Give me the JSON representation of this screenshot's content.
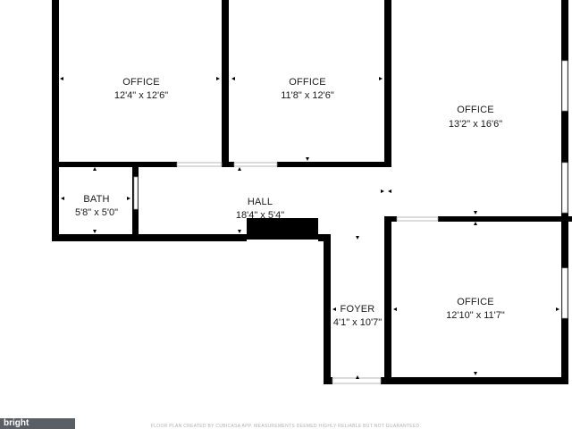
{
  "rooms": {
    "office_top_left": {
      "name": "OFFICE",
      "dim": "12'4\" x 12'6\""
    },
    "office_top_middle": {
      "name": "OFFICE",
      "dim": "11'8\" x 12'6\""
    },
    "office_right_large": {
      "name": "OFFICE",
      "dim": "13'2\" x 16'6\""
    },
    "bath": {
      "name": "BATH",
      "dim": "5'8\" x 5'0\""
    },
    "hall": {
      "name": "HALL",
      "dim": "18'4\" x 5'4\""
    },
    "foyer": {
      "name": "FOYER",
      "dim": "4'1\" x 10'7\""
    },
    "office_bottom_right": {
      "name": "OFFICE",
      "dim": "12'10\" x 11'7\""
    }
  },
  "footer": {
    "note": "FLOOR PLAN CREATED BY CUBICASA APP. MEASUREMENTS DEEMED HIGHLY RELIABLE BUT NOT GUARANTEED.",
    "brand": "bright"
  },
  "colors": {
    "wall": "#000000",
    "background": "#ffffff",
    "window": "#dcdcdc"
  }
}
